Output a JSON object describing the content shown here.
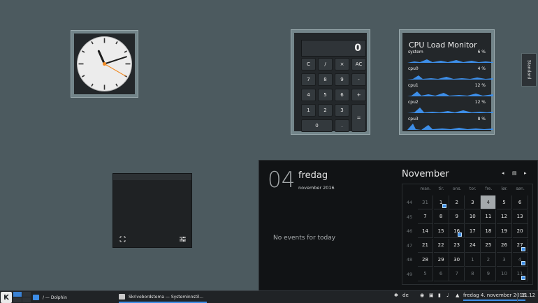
{
  "clock": {
    "hands": {
      "hour": 11,
      "minute": 12,
      "second": 20
    }
  },
  "calculator": {
    "display": "0",
    "buttons": [
      [
        "C",
        "/",
        "×",
        "AC"
      ],
      [
        "7",
        "8",
        "9",
        "-"
      ],
      [
        "4",
        "5",
        "6",
        "+"
      ],
      [
        "1",
        "2",
        "3",
        "="
      ],
      [
        "0",
        "."
      ]
    ]
  },
  "cpu": {
    "title": "CPU Load Monitor",
    "rows": [
      {
        "name": "system",
        "value": "6 %"
      },
      {
        "name": "cpu0",
        "value": "4 %"
      },
      {
        "name": "cpu1",
        "value": "12 %"
      },
      {
        "name": "cpu2",
        "value": "12 %"
      },
      {
        "name": "cpu3",
        "value": "8 %"
      }
    ],
    "graph_color": "#3d8ee8"
  },
  "side_tab": {
    "label": "Standard"
  },
  "calendar": {
    "big_day": "04",
    "weekday": "fredag",
    "month_year": "november 2016",
    "no_events": "No events for today",
    "month_title": "November",
    "nav": {
      "prev": "◂",
      "today": "▤",
      "next": "▸"
    },
    "weekday_headers": [
      "man.",
      "tir.",
      "ons.",
      "tor.",
      "fre.",
      "lør.",
      "søn."
    ],
    "weeks": [
      "44",
      "45",
      "46",
      "47",
      "48",
      "49"
    ],
    "days": [
      [
        "31",
        "1",
        "2",
        "3",
        "4",
        "5",
        "6"
      ],
      [
        "7",
        "8",
        "9",
        "10",
        "11",
        "12",
        "13"
      ],
      [
        "14",
        "15",
        "16",
        "17",
        "18",
        "19",
        "20"
      ],
      [
        "21",
        "22",
        "23",
        "24",
        "25",
        "26",
        "27"
      ],
      [
        "28",
        "29",
        "30",
        "1",
        "2",
        "3",
        "4"
      ],
      [
        "5",
        "6",
        "7",
        "8",
        "9",
        "10",
        "11"
      ]
    ]
  },
  "taskbar": {
    "launcher": "K",
    "tasks": [
      {
        "label": "/ — Dolphin"
      },
      {
        "label": "Skrivebordstema  — Systeminnstil..."
      }
    ],
    "keyboard_layout": "de",
    "datetime_label": "fredag 4. november 2016",
    "clock": "11.12"
  }
}
